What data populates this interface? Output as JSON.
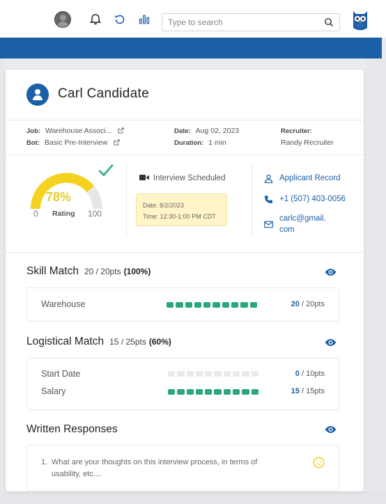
{
  "header": {
    "search_placeholder": "Type to search",
    "icons": [
      "avatar",
      "bell-icon",
      "refresh-icon",
      "bar-chart-icon",
      "search-icon",
      "owl-logo"
    ]
  },
  "candidate": {
    "name": "Carl Candidate"
  },
  "meta": {
    "job_label": "Job:",
    "job_value": "Warehouse Associ...",
    "bot_label": "Bot:",
    "bot_value": "Basic Pre-Interview",
    "date_label": "Date:",
    "date_value": "Aug 02, 2023",
    "duration_label": "Duration:",
    "duration_value": "1 min",
    "recruiter_label": "Recruiter:",
    "recruiter_value": "Randy Recruiter"
  },
  "rating": {
    "percent_text": "78%",
    "percent": 78,
    "label": "Rating",
    "min": "0",
    "max": "100",
    "color": "#f4d320"
  },
  "interview": {
    "status": "Interview Scheduled",
    "date_line": "Date: 8/2/2023",
    "time_line": "Time: 12:30-1:00 PM CDT"
  },
  "contact": {
    "record": "Applicant Record",
    "phone": "+1 (507) 403-0056",
    "email_line1": "carlc@gmail.",
    "email_line2": "com"
  },
  "skill_match": {
    "title": "Skill Match",
    "pts": "20 / 20pts",
    "pct": "(100%)",
    "rows": [
      {
        "label": "Warehouse",
        "score": "20",
        "total": "/ 20pts",
        "filled": 10,
        "segments": 10
      }
    ]
  },
  "logistical_match": {
    "title": "Logistical Match",
    "pts": "15 / 25pts",
    "pct": "(60%)",
    "rows": [
      {
        "label": "Start Date",
        "score": "0",
        "total": "/ 10pts",
        "filled": 0,
        "segments": 10
      },
      {
        "label": "Salary",
        "score": "15",
        "total": "/ 15pts",
        "filled": 10,
        "segments": 10
      }
    ]
  },
  "written_responses": {
    "title": "Written Responses",
    "questions": [
      {
        "num": "1.",
        "text": "What are your thoughts on this interview process, in terms of usability, etc...."
      }
    ]
  },
  "colors": {
    "brand_blue": "#1b5fa8",
    "green": "#2aa77a",
    "yellow": "#f4d320"
  }
}
